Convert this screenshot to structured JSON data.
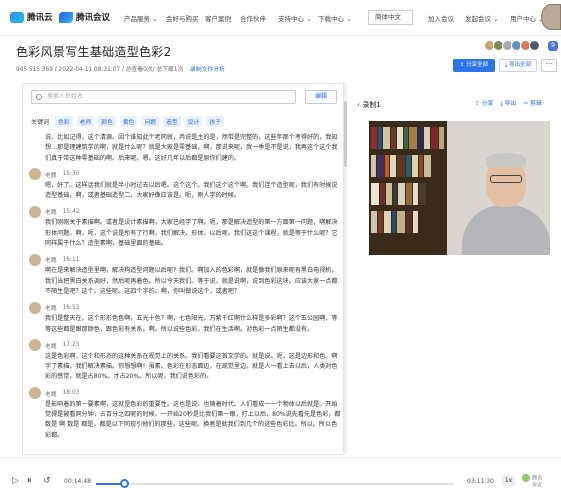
{
  "nav": {
    "logo1": "腾讯云",
    "logo2": "腾讯会议",
    "items": [
      "产品服务 ⌄",
      "会好与购买",
      "客户案例",
      "合作伙伴",
      "支持中心 ⌄",
      "下载中心 ⌄"
    ],
    "language": "简体中文",
    "join": "加入会议",
    "schedule": "发起会议 ⌄",
    "user_center": "用户中心 ⌄"
  },
  "page": {
    "title": "色彩风景写生基础造型色彩2",
    "meta": "945 515 369 / 2022-04-11 08:31:07 / 总查看0次/ 总下载1次",
    "meta_link": "录制文件分析",
    "avatar_count": "9",
    "share_all": "分享全部",
    "export_all": "导出全部",
    "more": "···"
  },
  "transcript": {
    "search_placeholder": "搜索人员姓名",
    "edit_label": "编辑",
    "keywords_label": "关键词",
    "keywords": [
      "色彩",
      "老师",
      "颜色",
      "黄色",
      "问题",
      "造型",
      "设计",
      "孩子"
    ],
    "segments": [
      {
        "name": "",
        "time": "",
        "text": "说、比如记得，这个清源。因个谁知此个老同就，冉说是主的是，然带是完整的，这些年那个考得好的，我知想…那是理建筑学的啊，就是什么呢？就是大家是零基础，啊，那说来呢，我一季是不是说，我再这个这个我们真于带这种零基础的啊。后来呢。嗯。这好几年以后都是原你们建的。"
      },
      {
        "name": "老魏",
        "time": "15:30",
        "text": "嗯，好了。这样话我们就是半小时过去以后嗯。这个这个。我们这个这个啊。我们连个造型呢，我们有时候说造型基础。啊，或者基础造型二，大家好像应该是。呃，刚人学的时候。"
      },
      {
        "name": "老魏",
        "time": "15:42",
        "text": "我们刚刚关于素描啊。或者是设计素描啊，大家已经学了啊。呃，那是解决造型的第一方面第一问题，啊解决形体问题。啊，呃，这个说是所有了行啊，我们解决。形体，以后呢。我们这这个课程，就是等于什么呢？它同样属于什么？造型素啊，基础里面的基础。"
      },
      {
        "name": "老魏",
        "time": "16:11",
        "text": "啊在是来解决造型里啊，解决构造型问题以后呢？我们。啊加入的色彩啊，就是像我们原来呢有黑白电视机，我们当把黑白关系调好，然后呢再着色。所以今天我们。等于说，就是说啊，说到色彩这块。应该大家一点都不陌生是吧？这个。这些呢。这四个字的。啊，你叫做说这个，或者吧？"
      },
      {
        "name": "老魏",
        "time": "16:52",
        "text": "我们是整天在。这个形形色色啊，五光十色？啊，七色阳光，万紫千红啊什么样是多彩啊？这个五公园啊，等等这些都是跟那颜色，跟色彩有关系。啊。所以说些色彩，我们在生活啊。对色彩一点陌生都没有。"
      },
      {
        "name": "老魏",
        "time": "17:23",
        "text": "这是色彩啊，这个和形态的这种关系在视觉上的关系。我们看要这首文学的。就是说。呃，这是边形和色。啊字了素描，我们解决素描。你想想啊！虽素。色彩在形态面边，在现觉里边。就是人一看上去以后，人类对色彩的感觉，就是占80%。才占20%。所以呢，我们说色彩的。"
      },
      {
        "name": "老魏",
        "time": "18:03",
        "text": "是影响着的第一要素啊，这就是色彩的重要性。这也是说。也随着时代。人们看成一一个物体以后就是。开始觉得是被看同分钟，占百分之四呢的时候。一开始20秒是比我们第一眼，打上以后，80%说先看先是色彩，都 数是 啊 数是 都是，都是以下同现引他们的那些。这些呢。换者是就我们到几个的这些色彩比。所以。所以色彩都。"
      }
    ]
  },
  "recording": {
    "title": "录制1",
    "share": "分享",
    "export": "导出",
    "clip": "剪辑"
  },
  "player": {
    "current_time": "00:14:48",
    "duration": "03:11:30",
    "progress": 0.077,
    "speed": "1x",
    "brand1": "腾讯",
    "brand2": "会议"
  },
  "colors": {
    "accent": "#2a74e8",
    "keyword_bg": "#eaf1fd"
  }
}
